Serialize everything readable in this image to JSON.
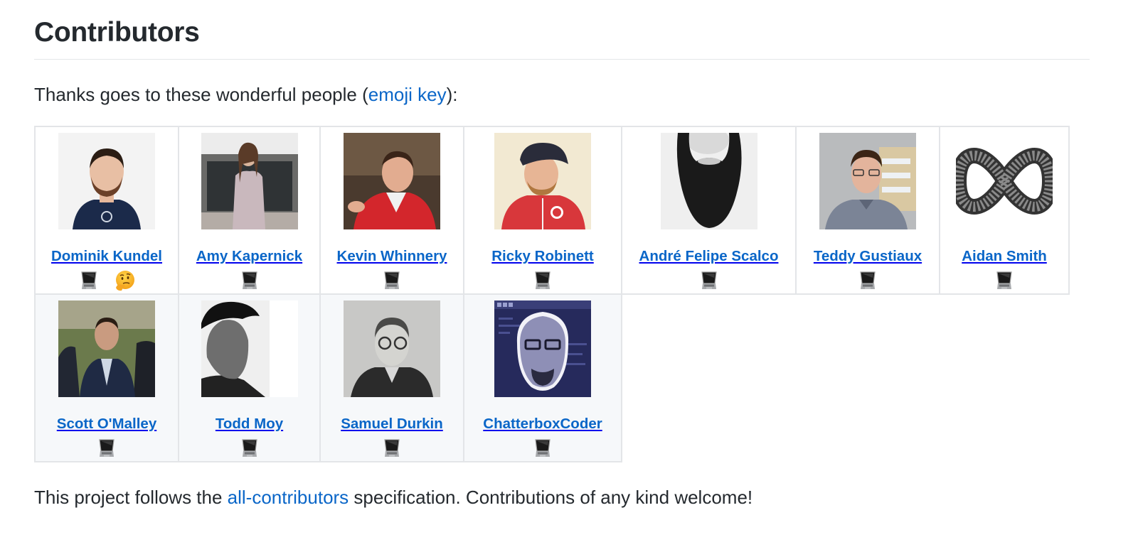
{
  "heading": "Contributors",
  "intro": {
    "before": "Thanks goes to these wonderful people (",
    "link": "emoji key",
    "after": "):"
  },
  "contributors": [
    {
      "name": "Dominik Kundel",
      "avatar": "avatar-dominik-kundel",
      "contributions": [
        "code",
        "ideas"
      ]
    },
    {
      "name": "Amy Kapernick",
      "avatar": "avatar-amy-kapernick",
      "contributions": [
        "code"
      ]
    },
    {
      "name": "Kevin Whinnery",
      "avatar": "avatar-kevin-whinnery",
      "contributions": [
        "code"
      ]
    },
    {
      "name": "Ricky Robinett",
      "avatar": "avatar-ricky-robinett",
      "contributions": [
        "code"
      ]
    },
    {
      "name": "André Felipe Scalco",
      "avatar": "avatar-andre-felipe-scalco",
      "contributions": [
        "code"
      ]
    },
    {
      "name": "Teddy Gustiaux",
      "avatar": "avatar-teddy-gustiaux",
      "contributions": [
        "code"
      ]
    },
    {
      "name": "Aidan Smith",
      "avatar": "avatar-aidan-smith",
      "contributions": [
        "code"
      ]
    },
    {
      "name": "Scott O'Malley",
      "avatar": "avatar-scott-omalley",
      "contributions": [
        "code"
      ]
    },
    {
      "name": "Todd Moy",
      "avatar": "avatar-todd-moy",
      "contributions": [
        "code"
      ]
    },
    {
      "name": "Samuel Durkin",
      "avatar": "avatar-samuel-durkin",
      "contributions": [
        "code"
      ]
    },
    {
      "name": "ChatterboxCoder",
      "avatar": "avatar-chatterboxcoder",
      "contributions": [
        "code"
      ]
    }
  ],
  "contribution_icons": {
    "code": "laptop-icon",
    "ideas": "thinking-face-icon"
  },
  "footer": {
    "before": "This project follows the ",
    "link": "all-contributors",
    "after": " specification. Contributions of any kind welcome!"
  },
  "colors": {
    "link": "#0a66c8",
    "text": "#24292e",
    "border": "#e3e5e8",
    "alt_row_bg": "#f6f8fa"
  }
}
